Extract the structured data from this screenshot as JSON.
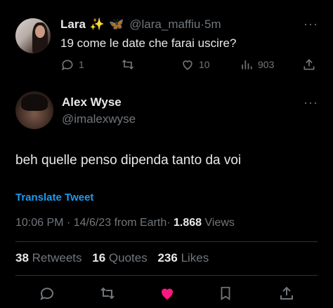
{
  "reply_tweet": {
    "name": "Lara",
    "emoji_1": "✨",
    "emoji_2": "🦋",
    "handle": "@lara_maffiu",
    "time_sep": "·",
    "time": "5m",
    "text": "19 come le date che farai uscire?",
    "replies": "1",
    "likes": "10",
    "views": "903"
  },
  "main_tweet": {
    "name": "Alex Wyse",
    "handle": "@imalexwyse",
    "text": "beh quelle penso dipenda tanto da voi",
    "translate_label": "Translate Tweet",
    "time": "10:06 PM",
    "sep1": "·",
    "date": "14/6/23",
    "source": "from Earth",
    "sep2": "·",
    "views_count": "1.868",
    "views_label": "Views",
    "retweets_count": "38",
    "retweets_label": "Retweets",
    "quotes_count": "16",
    "quotes_label": "Quotes",
    "likes_count": "236",
    "likes_label": "Likes"
  },
  "colors": {
    "background": "#000000",
    "text": "#e7e9ea",
    "muted": "#71767b",
    "link": "#1d9bf0",
    "liked": "#f91880",
    "divider": "#2f3336"
  },
  "icons": [
    "reply-icon",
    "retweet-icon",
    "like-icon",
    "views-icon",
    "share-icon",
    "more-icon",
    "bookmark-icon"
  ]
}
